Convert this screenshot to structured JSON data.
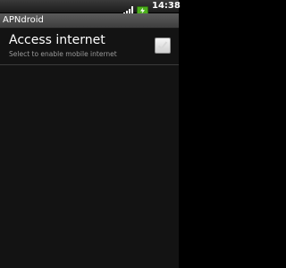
{
  "status_bar": {
    "time": "14:38",
    "signal_icon": "signal-bars-icon",
    "battery_icon": "battery-charging-icon",
    "battery_color": "#4caf1c"
  },
  "app": {
    "title": "APNdroid"
  },
  "preferences": [
    {
      "title": "Access internet",
      "summary": "Select to enable mobile internet",
      "checked": false
    }
  ]
}
